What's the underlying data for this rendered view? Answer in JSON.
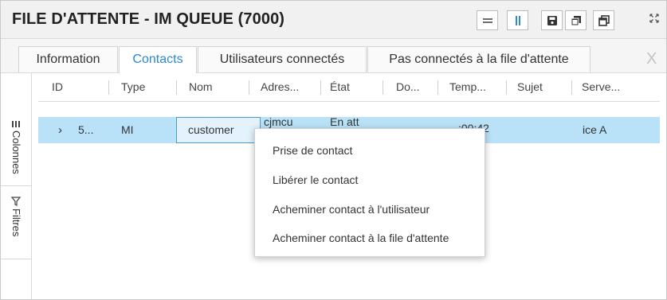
{
  "window": {
    "title": "FILE D'ATTENTE - IM QUEUE (7000)"
  },
  "toolbar": {
    "icons": [
      "equals-icon",
      "columns-icon",
      "save-icon",
      "copy-icon",
      "restore-icon",
      "collapse-icon"
    ]
  },
  "tabs": [
    {
      "label": "Information",
      "active": false
    },
    {
      "label": "Contacts",
      "active": true
    },
    {
      "label": "Utilisateurs connectés",
      "active": false
    },
    {
      "label": "Pas connectés à la file d'attente",
      "active": false
    }
  ],
  "tabs_close_label": "X",
  "side_panel": {
    "columns_label": "Colonnes",
    "filters_label": "Filtres"
  },
  "grid": {
    "columns": [
      "ID",
      "Type",
      "Nom",
      "Adres...",
      "État",
      "Do...",
      "Temp...",
      "Sujet",
      "Serve..."
    ],
    "row": {
      "expander": "›",
      "id": "5...",
      "type": "MI",
      "nom": "customer",
      "adresse": "cjmcu",
      "etat": "En att",
      "temps": ":00:42",
      "serveur": "ice A"
    }
  },
  "context_menu": {
    "items": [
      "Prise de contact",
      "Libérer le contact",
      "Acheminer contact à l'utilisateur",
      "Acheminer contact à la file d'attente"
    ]
  },
  "colors": {
    "accent": "#2b8ad0",
    "row_selected": "#b9e2f8",
    "cell_border": "#4a9bd5"
  }
}
